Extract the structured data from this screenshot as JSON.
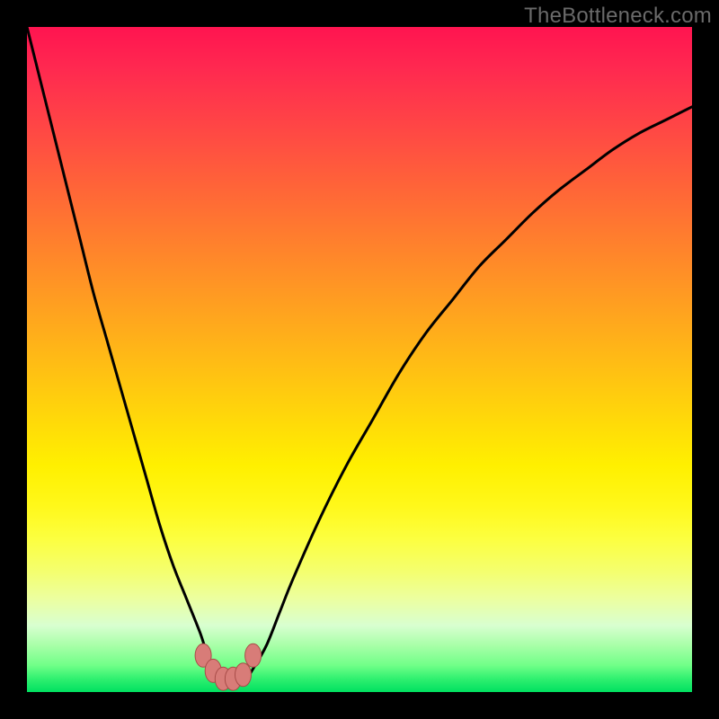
{
  "watermark": "TheBottleneck.com",
  "colors": {
    "background": "#000000",
    "curve_stroke": "#000000",
    "marker_fill": "#d87c78",
    "marker_stroke": "#a84c48"
  },
  "chart_data": {
    "type": "line",
    "title": "",
    "xlabel": "",
    "ylabel": "",
    "xlim": [
      0,
      100
    ],
    "ylim": [
      0,
      100
    ],
    "grid": false,
    "series": [
      {
        "name": "bottleneck-curve",
        "x": [
          0,
          2,
          4,
          6,
          8,
          10,
          12,
          14,
          16,
          18,
          20,
          22,
          24,
          26,
          27,
          28,
          29,
          30,
          31,
          32,
          33,
          34,
          36,
          38,
          40,
          44,
          48,
          52,
          56,
          60,
          64,
          68,
          72,
          76,
          80,
          84,
          88,
          92,
          96,
          100
        ],
        "values": [
          100,
          92,
          84,
          76,
          68,
          60,
          53,
          46,
          39,
          32,
          25,
          19,
          14,
          9,
          6,
          3.8,
          2.2,
          1.2,
          1,
          1.2,
          2,
          3.5,
          7,
          12,
          17,
          26,
          34,
          41,
          48,
          54,
          59,
          64,
          68,
          72,
          75.5,
          78.5,
          81.5,
          84,
          86,
          88
        ]
      }
    ],
    "markers": [
      {
        "x": 26.5,
        "y": 5.5
      },
      {
        "x": 28.0,
        "y": 3.2
      },
      {
        "x": 29.5,
        "y": 2.0
      },
      {
        "x": 31.0,
        "y": 2.0
      },
      {
        "x": 32.5,
        "y": 2.6
      },
      {
        "x": 34.0,
        "y": 5.5
      }
    ]
  }
}
